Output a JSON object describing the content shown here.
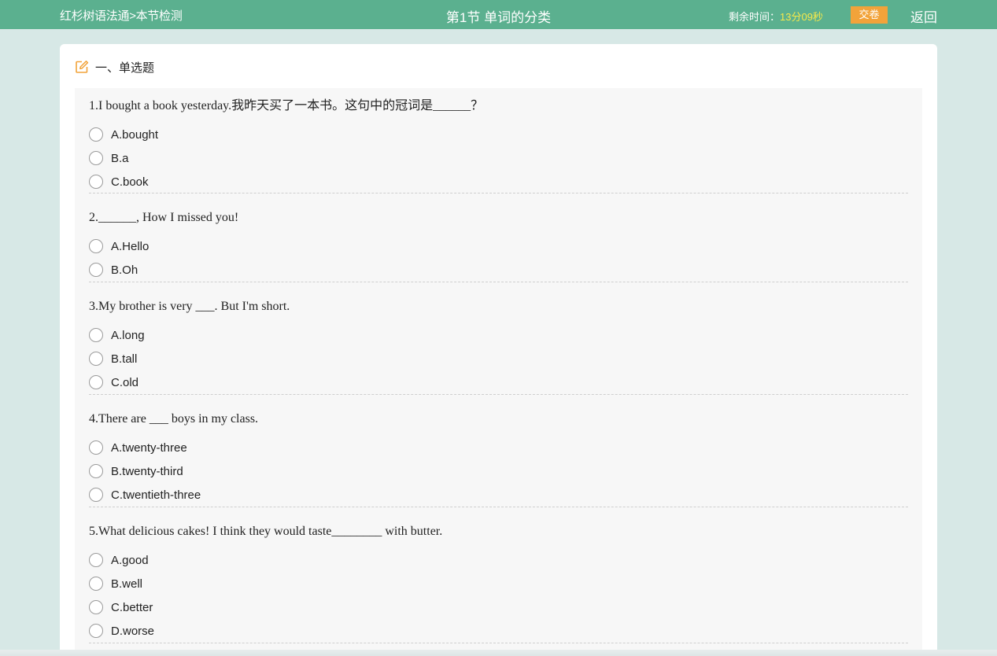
{
  "header": {
    "breadcrumb": "红杉树语法通>本节检测",
    "title": "第1节 单词的分类",
    "timer_label": "剩余时间：",
    "timer_value": "13分09秒",
    "submit_label": "交卷",
    "back_label": "返回"
  },
  "colors": {
    "header_bg": "#5bb08f",
    "page_bg": "#d7e8e6",
    "timer_value": "#f7e94a",
    "submit_bg": "#f2a33a",
    "section_icon": "#f2a33a"
  },
  "section": {
    "icon": "edit-icon",
    "title": "一、单选题"
  },
  "questions": [
    {
      "text": "1.I bought a book yesterday.我昨天买了一本书。这句中的冠词是______？",
      "options": [
        "A.bought",
        "B.a",
        "C.book"
      ]
    },
    {
      "text": "2.______, How I missed you!",
      "options": [
        "A.Hello",
        "B.Oh"
      ]
    },
    {
      "text": "3.My brother is very ___. But I'm short.",
      "options": [
        "A.long",
        "B.tall",
        "C.old"
      ]
    },
    {
      "text": "4.There are ___ boys in my class.",
      "options": [
        "A.twenty-three",
        "B.twenty-third",
        "C.twentieth-three"
      ]
    },
    {
      "text": "5.What delicious cakes! I think they would taste________ with butter.",
      "options": [
        "A.good",
        "B.well",
        "C.better",
        "D.worse"
      ]
    }
  ]
}
